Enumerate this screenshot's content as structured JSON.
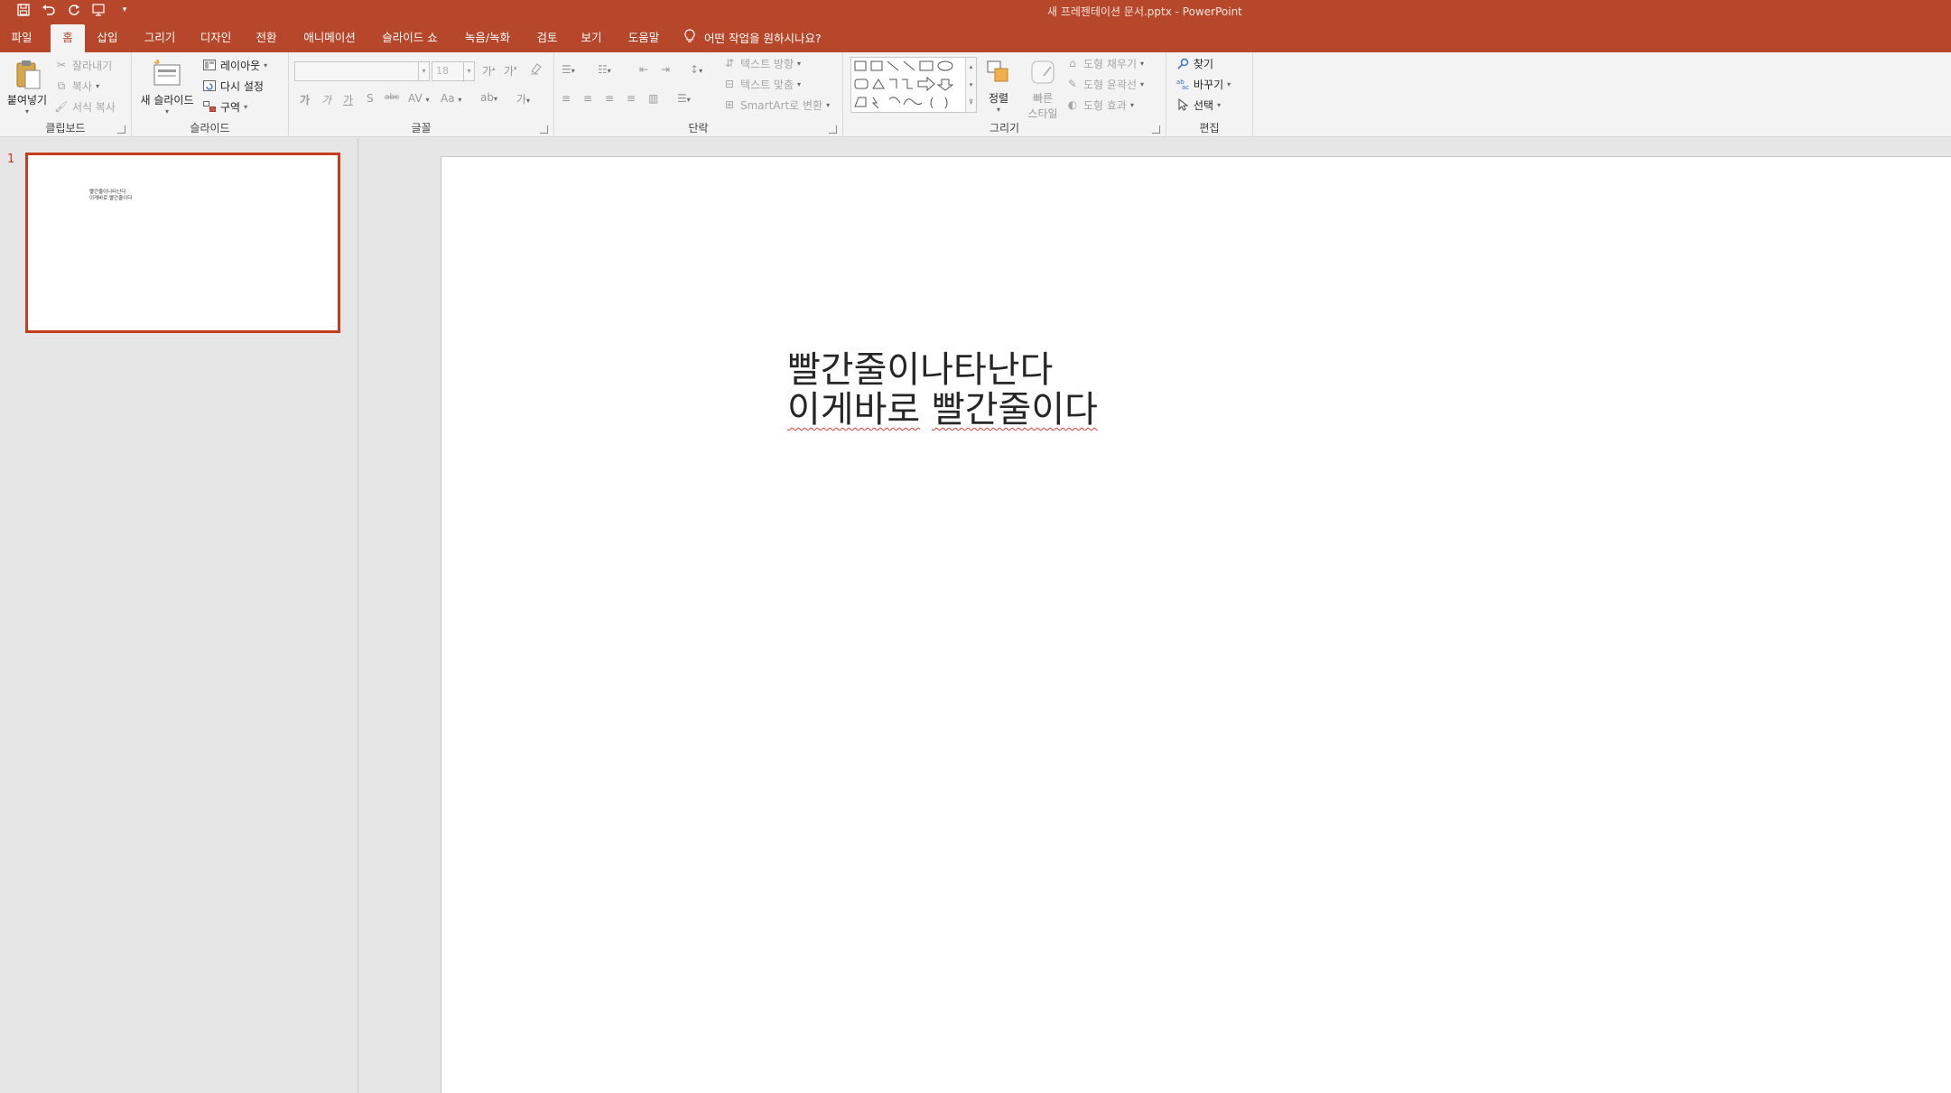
{
  "app": {
    "title": "새 프레젠테이션 문서.pptx  -  PowerPoint",
    "colors": {
      "accent": "#b7472a",
      "ribbon_bg": "#f3f3f3",
      "pane_bg": "#e6e6e6",
      "selection": "#c43e1c"
    }
  },
  "qat": {
    "save_icon": "save-icon",
    "undo_icon": "undo-icon",
    "redo_icon": "redo-icon",
    "present_icon": "present-from-start-icon",
    "customize_icon": "customize-qat-icon"
  },
  "tabs": [
    {
      "label": "파일"
    },
    {
      "label": "홈"
    },
    {
      "label": "삽입"
    },
    {
      "label": "그리기"
    },
    {
      "label": "디자인"
    },
    {
      "label": "전환"
    },
    {
      "label": "애니메이션"
    },
    {
      "label": "슬라이드 쇼"
    },
    {
      "label": "녹음/녹화"
    },
    {
      "label": "검토"
    },
    {
      "label": "보기"
    },
    {
      "label": "도움말"
    }
  ],
  "tellme": {
    "label": "어떤 작업을 원하시나요?"
  },
  "ribbon": {
    "clipboard": {
      "label": "클립보드",
      "paste": "붙여넣기",
      "cut": "잘라내기",
      "copy": "복사",
      "format_painter": "서식 복사"
    },
    "slides": {
      "label": "슬라이드",
      "new_slide": "새 슬라이드",
      "layout": "레이아웃",
      "reset": "다시 설정",
      "section": "구역"
    },
    "font": {
      "label": "글꼴",
      "font_name": "",
      "font_size": "18",
      "bold": "가",
      "italic": "가",
      "underline": "가",
      "shadow": "S",
      "strike": "abc",
      "spacing": "AV",
      "case": "Aa"
    },
    "paragraph": {
      "label": "단락",
      "text_direction": "텍스트 방향",
      "align_text": "텍스트 맞춤",
      "smartart": "SmartArt로 변환"
    },
    "drawing": {
      "label": "그리기",
      "arrange": "정렬",
      "quick_styles_1": "빠른",
      "quick_styles_2": "스타일",
      "shape_fill": "도형 채우기",
      "shape_outline": "도형 윤곽선",
      "shape_effects": "도형 효과"
    },
    "editing": {
      "label": "편집",
      "find": "찾기",
      "replace": "바꾸기",
      "select": "선택"
    }
  },
  "thumbnails": [
    {
      "number": "1",
      "line1": "빨간줄이나타난다",
      "line2": "이게바로 빨간줄이다"
    }
  ],
  "slide": {
    "line1": "빨간줄이나타난다",
    "line2_word1": "이게바로",
    "line2_word2": "빨간줄이다"
  }
}
